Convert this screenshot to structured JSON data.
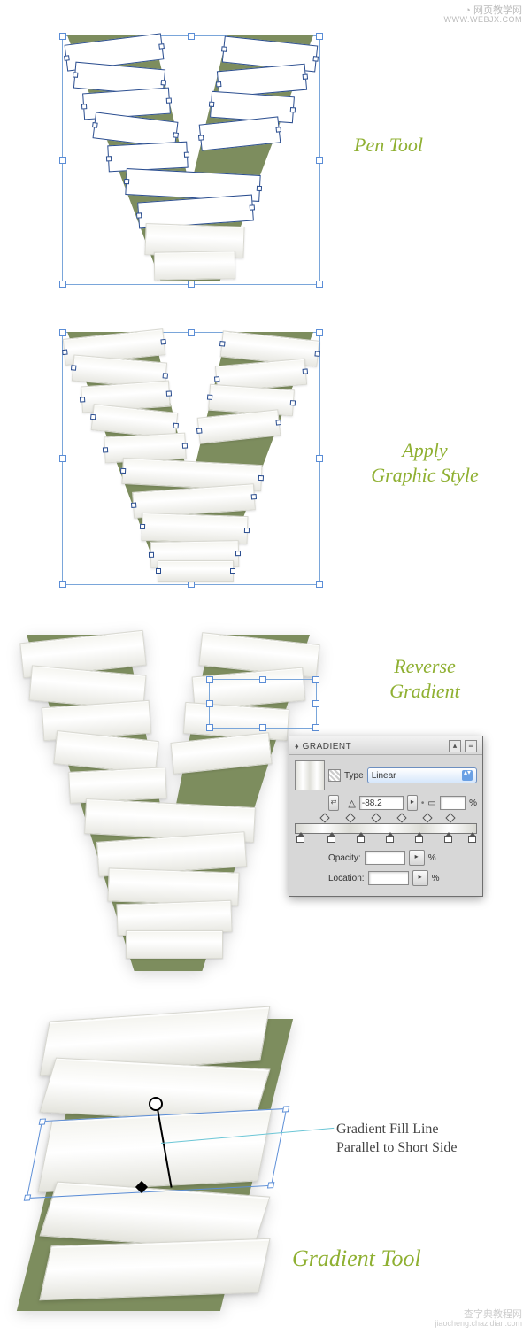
{
  "watermarks": {
    "top_cn": "网页教学网",
    "top_domain": "WWW.WEBJX.COM",
    "bottom_cn": "查字典教程网",
    "bottom_domain": "jiaocheng.chazidian.com"
  },
  "labels": {
    "pen_tool": "Pen Tool",
    "apply_style_l1": "Apply",
    "apply_style_l2": "Graphic Style",
    "reverse_l1": "Reverse",
    "reverse_l2": "Gradient",
    "gradient_tool": "Gradient Tool",
    "fill_line_l1": "Gradient Fill Line",
    "fill_line_l2": "Parallel to Short Side"
  },
  "panel": {
    "title": "GRADIENT",
    "type_label": "Type",
    "type_value": "Linear",
    "angle_value": "-88.2",
    "ratio_value": "",
    "ratio_suffix": "%",
    "opacity_label": "Opacity:",
    "opacity_suffix": "%",
    "location_label": "Location:",
    "location_suffix": "%"
  }
}
